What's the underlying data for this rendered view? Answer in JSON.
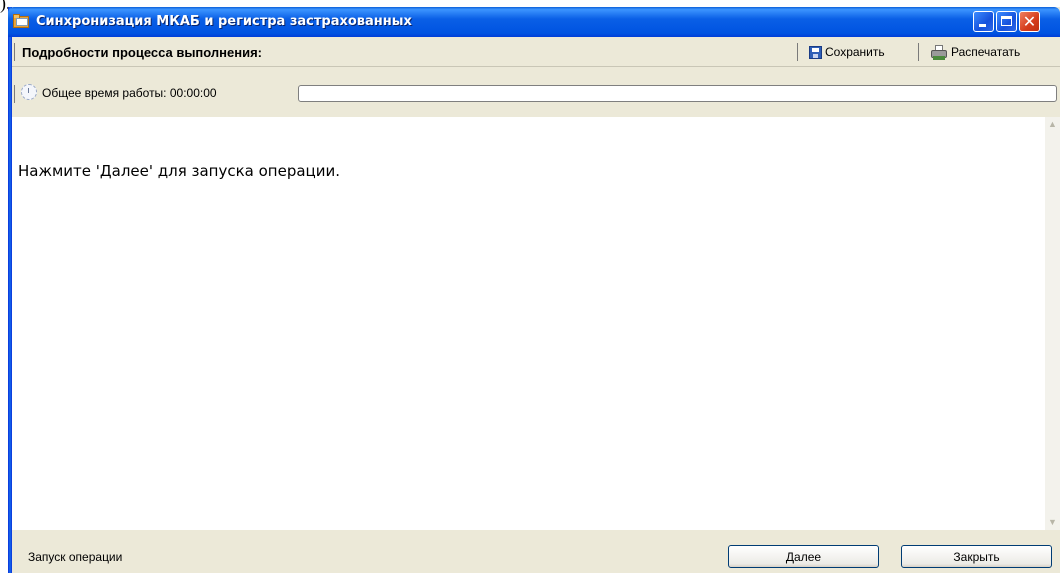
{
  "stray_text": ").",
  "window": {
    "title": "Синхронизация МКАБ и регистра застрахованных",
    "controls": {
      "minimize": "minimize",
      "maximize": "maximize",
      "close": "close"
    }
  },
  "header": {
    "title": "Подробности процесса выполнения:",
    "save_label": "Сохранить",
    "print_label": "Распечатать"
  },
  "timer": {
    "label": "Общее время работы: 00:00:00",
    "progress_value": 0
  },
  "content": {
    "message": "Нажмите 'Далее' для запуска операции."
  },
  "footer": {
    "status": "Запуск операции",
    "next_label": "Далее",
    "close_label": "Закрыть"
  },
  "colors": {
    "titlebar": "#0a5fe6",
    "chrome": "#ece9d8",
    "close_button": "#d43c1c"
  }
}
